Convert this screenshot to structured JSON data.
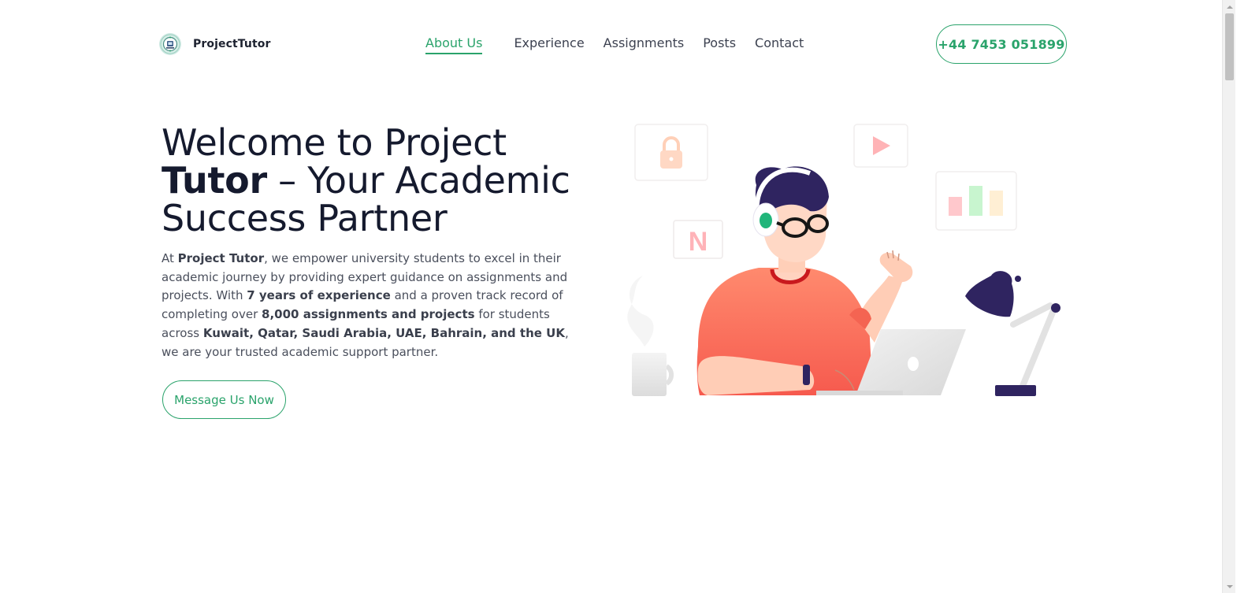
{
  "header": {
    "brand_name": "ProjectTutor",
    "nav": [
      {
        "label": "About Us",
        "active": true
      },
      {
        "label": "Experience",
        "active": false
      },
      {
        "label": "Assignments",
        "active": false
      },
      {
        "label": "Posts",
        "active": false
      },
      {
        "label": "Contact",
        "active": false
      }
    ],
    "phone": "+44 7453 051899"
  },
  "hero": {
    "title_part1": "Welcome to Project",
    "title_strong": "Tutor",
    "title_part2": " – Your Academic Success Partner",
    "text": {
      "t1": "At ",
      "b1": "Project Tutor",
      "t2": ", we empower university students to excel in their academic journey by providing expert guidance on assignments and projects. With ",
      "b2": "7 years of experience",
      "t3": " and a proven track record of completing over ",
      "b3": "8,000 assignments and projects",
      "t4": " for students across ",
      "b4": "Kuwait, Qatar, Saudi Arabia, UAE, Bahrain, and the UK",
      "t5": ", we are your trusted academic support partner."
    },
    "cta_label": "Message Us Now"
  },
  "illustration": {
    "badge_letter": "N"
  },
  "colors": {
    "accent": "#2aa36b",
    "heading": "#151a2e",
    "shirt": "#fa6e5a",
    "hair": "#2f2460"
  },
  "icons": [
    "brand-logo-icon",
    "lock-icon",
    "play-icon",
    "bar-chart-icon",
    "netflix-icon",
    "desk-lamp-icon",
    "coffee-mug-icon",
    "laptop-icon"
  ]
}
